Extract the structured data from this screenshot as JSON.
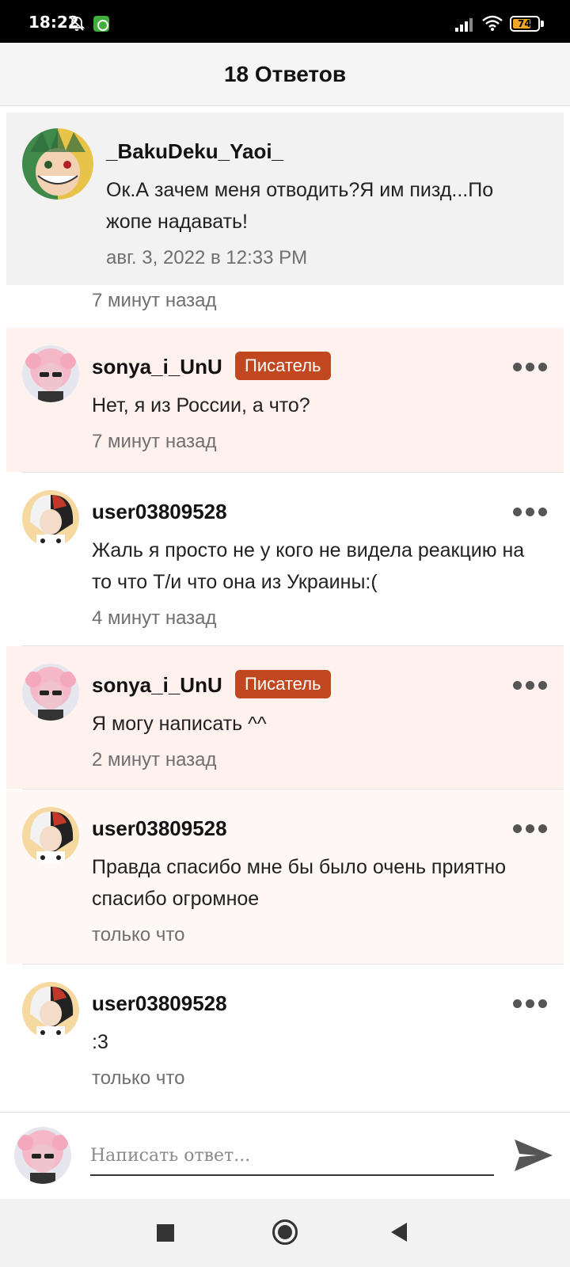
{
  "status_bar": {
    "time": "18:22",
    "battery_level": "74",
    "icons": [
      "bell-off-icon",
      "app-notification-icon",
      "signal-icon",
      "wifi-icon",
      "battery-icon"
    ]
  },
  "header": {
    "title": "18 Ответов"
  },
  "parent_comment": {
    "username": "_BakuDeku_Yaoi_",
    "text": "Ок.А зачем меня отводить?Я им пизд...По жопе надавать!",
    "date": "авг. 3, 2022 в 12:33 PM",
    "time_ago": "7 минут назад"
  },
  "replies": [
    {
      "username": "sonya_i_UnU",
      "badge": "Писатель",
      "text": "Нет, я из России, а что?",
      "time": "7 минут назад"
    },
    {
      "username": "user03809528",
      "text": "Жаль я просто не у кого не видела реакцию на то что Т/и что она из Украины:(",
      "time": "4 минут назад"
    },
    {
      "username": "sonya_i_UnU",
      "badge": "Писатель",
      "text": "Я могу написать ^^",
      "time": "2 минут назад"
    },
    {
      "username": "user03809528",
      "text": "Правда спасибо мне бы было очень приятно спасибо огромное",
      "time": "только что"
    },
    {
      "username": "user03809528",
      "text": ":3",
      "time": "только что"
    }
  ],
  "composer": {
    "placeholder": "Написать ответ..."
  },
  "colors": {
    "badge": "#c0471f",
    "writer_bg": "#fff2ee",
    "parent_bg": "#f2f2f2"
  }
}
